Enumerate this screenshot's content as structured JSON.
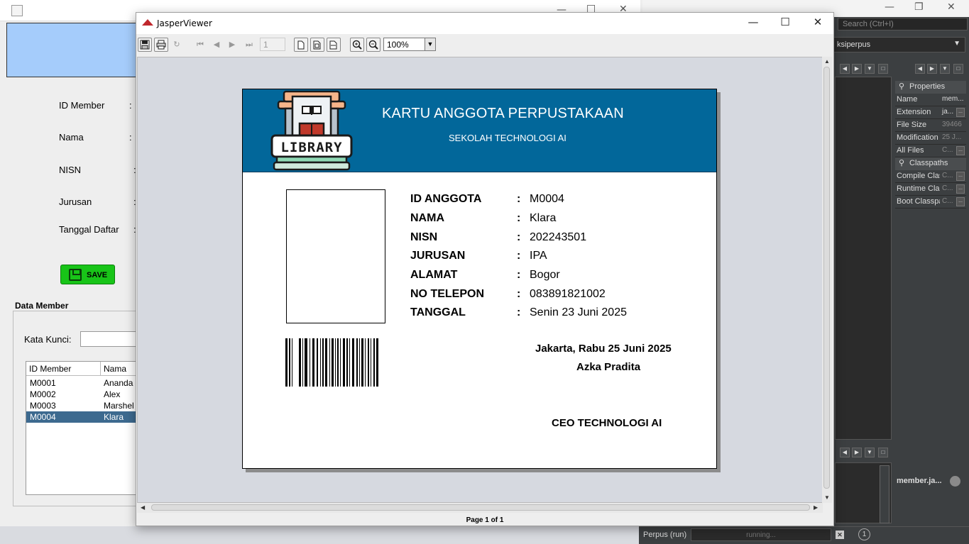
{
  "ide": {
    "search_placeholder": "Search (Ctrl+I)",
    "project_combo": "ksiperpus",
    "properties": {
      "header": "Properties",
      "rows": [
        {
          "key": "Name",
          "value": "mem..."
        },
        {
          "key": "Extension",
          "value": "ja..."
        },
        {
          "key": "File Size",
          "value": "39466"
        },
        {
          "key": "Modification",
          "value": "25 J..."
        },
        {
          "key": "All Files",
          "value": "C..."
        }
      ]
    },
    "classpaths": {
      "header": "Classpaths",
      "rows": [
        {
          "key": "Compile Clas",
          "value": "C..."
        },
        {
          "key": "Runtime Clas",
          "value": "C..."
        },
        {
          "key": "Boot Classpa",
          "value": "C..."
        }
      ]
    },
    "navigator_file": "member.ja...",
    "run_label": "Perpus (run)",
    "run_status": "running...",
    "notifications": "1"
  },
  "form": {
    "labels": {
      "id_member": "ID Member",
      "nama": "Nama",
      "nisn": "NISN",
      "jurusan": "Jurusan",
      "tanggal_daftar": "Tanggal Daftar"
    },
    "colon": ":",
    "save_label": "SAVE",
    "data_member_title": "Data Member",
    "kata_kunci_label": "Kata Kunci:",
    "table": {
      "headers": [
        "ID Member",
        "Nama"
      ],
      "rows": [
        [
          "M0001",
          "Ananda"
        ],
        [
          "M0002",
          "Alex"
        ],
        [
          "M0003",
          "Marshel"
        ],
        [
          "M0004",
          "Klara"
        ]
      ],
      "selected_index": 3
    }
  },
  "viewer": {
    "window_title": "JasperViewer",
    "page_number": "1",
    "zoom": "100%",
    "status": "Page 1 of 1",
    "colors": {
      "banner": "#02679a",
      "canvas": "#d6d9e0"
    }
  },
  "card": {
    "title": "KARTU ANGGOTA PERPUSTAKAAN",
    "subtitle": "SEKOLAH TECHNOLOGI AI",
    "logo_text": "LIBRARY",
    "fields": [
      {
        "label": "ID ANGGOTA",
        "value": "M0004"
      },
      {
        "label": "NAMA",
        "value": "Klara"
      },
      {
        "label": "NISN",
        "value": "202243501"
      },
      {
        "label": "JURUSAN",
        "value": "IPA"
      },
      {
        "label": "ALAMAT",
        "value": "Bogor"
      },
      {
        "label": "NO TELEPON",
        "value": "083891821002"
      },
      {
        "label": "TANGGAL",
        "value": "Senin 23 Juni 2025"
      }
    ],
    "colon": ":",
    "sign_date": "Jakarta,  Rabu 25 Juni 2025",
    "sign_name": "Azka Pradita",
    "sign_role": "CEO TECHNOLOGI AI"
  }
}
